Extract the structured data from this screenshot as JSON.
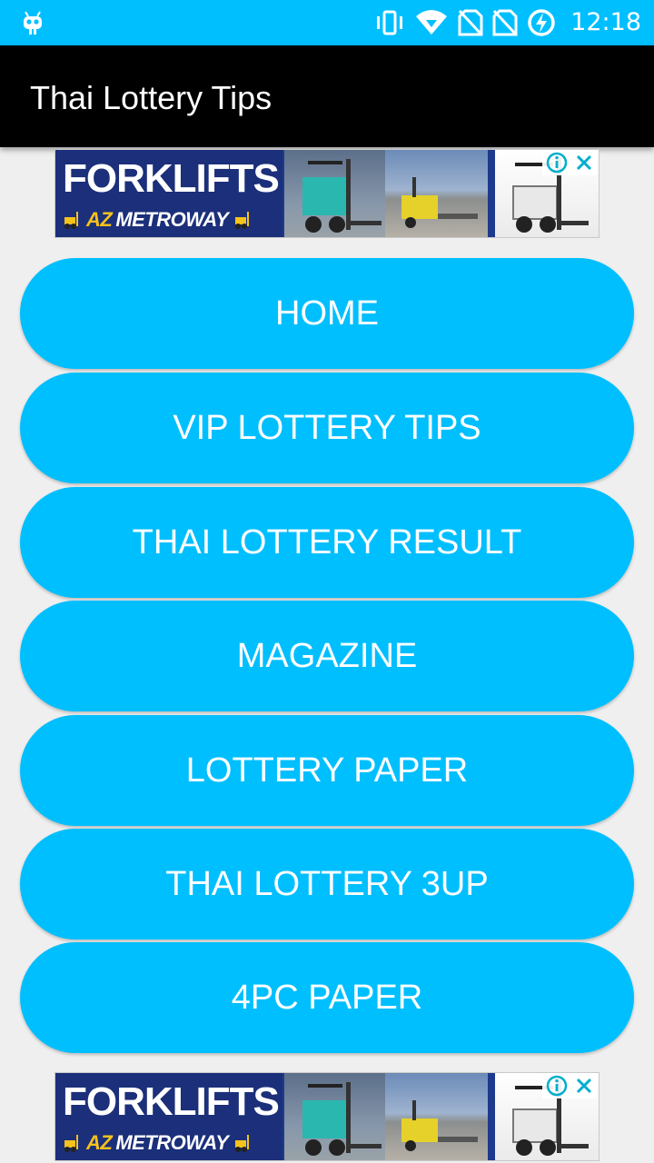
{
  "status_bar": {
    "time": "12:18",
    "icons": [
      "android-icon",
      "vibrate-icon",
      "wifi-icon",
      "no-sim-icon",
      "no-sim-icon",
      "battery-charging-icon"
    ],
    "background": "#00bfff"
  },
  "app_bar": {
    "title": "Thai Lottery Tips",
    "background": "#000000"
  },
  "ads": [
    {
      "brand": "FORKLIFTS",
      "sub_prefix": "AZ",
      "sub_text": "METROWAY",
      "icons": [
        "info-icon",
        "close-icon"
      ]
    },
    {
      "brand": "FORKLIFTS",
      "sub_prefix": "AZ",
      "sub_text": "METROWAY",
      "icons": [
        "info-icon",
        "close-icon"
      ]
    }
  ],
  "menu": {
    "button_color": "#00bfff",
    "buttons": [
      {
        "label": "HOME"
      },
      {
        "label": "VIP LOTTERY TIPS"
      },
      {
        "label": "THAI LOTTERY RESULT"
      },
      {
        "label": "MAGAZINE"
      },
      {
        "label": "LOTTERY PAPER"
      },
      {
        "label": "THAI LOTTERY 3UP"
      },
      {
        "label": "4PC PAPER"
      }
    ]
  }
}
